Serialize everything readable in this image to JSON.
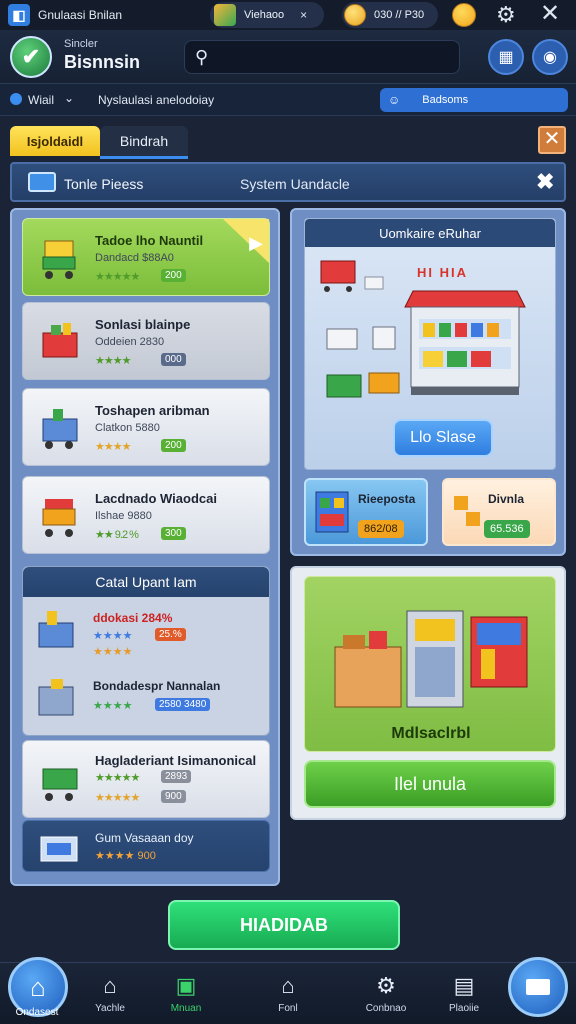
{
  "topbar": {
    "app_name": "Gnulaasi Bnilan",
    "chip1_label": "Viehaoo",
    "chip1_close": "×",
    "coins": "030 // P30"
  },
  "header": {
    "logo_sub": "Sincler",
    "logo_title": "Bisnnsin",
    "search_placeholder": ""
  },
  "subbar": {
    "location": "Wiail",
    "breadcrumb": "Nyslaulasi anelodoiay",
    "pill_label": "Badsoms"
  },
  "tabs": {
    "tab1": "Isjoldaidl",
    "tab2": "Bindrah"
  },
  "titlebar": {
    "title": "Tonle Pieess",
    "center": "System Uandacle"
  },
  "cards": [
    {
      "name": "Tadoe lho Nauntil",
      "sub": "Dandacd $88A0",
      "stars": "★★★★★",
      "val": "200"
    },
    {
      "name": "Sonlasi blainpe",
      "sub": "Oddeien 2830",
      "stars": "★★★★",
      "val": "000"
    },
    {
      "name": "Toshapen aribman",
      "sub": "Clatkon 5880",
      "stars": "★★★★",
      "val": "200"
    },
    {
      "name": "Lacdnado Wiaodcai",
      "sub": "Ilshae 9880",
      "stars": "★★ 9.2 %",
      "val": "300"
    }
  ],
  "section": {
    "title": "Catal Upant Iam",
    "row1_name": "ddokasi 284%",
    "row1_stars": "★★★★",
    "row1_val": "25.%",
    "row1_stars2": "★★★★",
    "row2_name": "Bondadespr Nannalan",
    "row2_stars": "★★★★",
    "row2_val": "2580 3480"
  },
  "card5": {
    "name": "Hagladeriant Isimanonical",
    "stars": "★★★★★",
    "val": "2893",
    "stars2": "★★★★★",
    "val2": "900"
  },
  "bottomrow": {
    "name": "Gum Vasaaan doy",
    "stars": "★★★★ 900"
  },
  "rightpanel": {
    "head": "Uomkaire eRuhar",
    "store_sign": "HI HIA",
    "button": "Llo Slase",
    "mini1_title": "Rieeposta",
    "mini1_val": "862/08",
    "mini2_title": "Divnla",
    "mini2_val": "65.536"
  },
  "rightpanel2": {
    "label": "Mdlsaclrbl",
    "button": "Ilel unula"
  },
  "main_button": "HIADIDAB",
  "nav": [
    {
      "label": "Ondasest",
      "icon": "home-icon"
    },
    {
      "label": "Yachle",
      "icon": "house-icon"
    },
    {
      "label": "Mnuan",
      "icon": "cart-icon"
    },
    {
      "label": "Fonl",
      "icon": "shop-icon"
    },
    {
      "label": "Conbnao",
      "icon": "gear-icon"
    },
    {
      "label": "Plaoiie",
      "icon": "board-icon"
    }
  ]
}
